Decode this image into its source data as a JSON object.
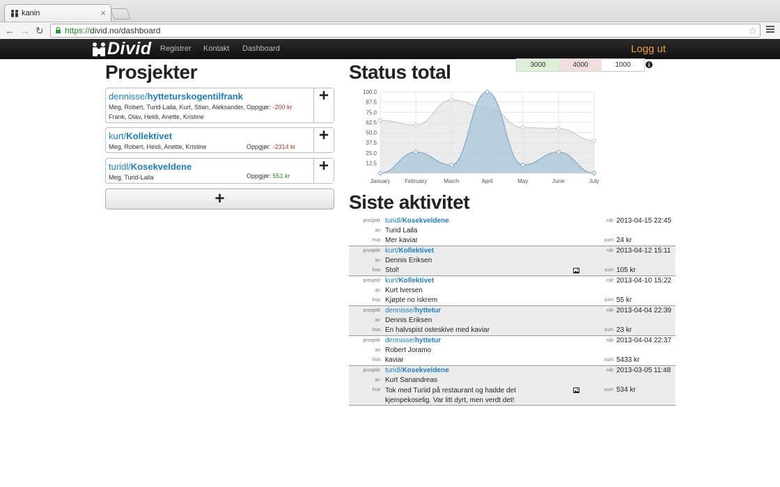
{
  "browser": {
    "tab_title": "kanin",
    "tab_close": "×",
    "url_https": "https://",
    "url_rest": "divid.no/dashboard",
    "back": "←",
    "forward": "→",
    "reload": "↻",
    "star": "☆"
  },
  "nav": {
    "brand": "Divid",
    "links": [
      "Registrer",
      "Kontakt",
      "Dashboard"
    ],
    "logout": "Logg ut"
  },
  "projects": {
    "title": "Prosjekter",
    "settle_label": "Oppgjør:",
    "add_symbol": "+",
    "items": [
      {
        "owner": "dennisse/",
        "name": "hytteturskogentilfrank",
        "members": "Meg, Robert, Turid-Laila, Kurt, Stian, Aleksander, Frank, Olav, Heidi, Anette, Kristine",
        "amount": "-200 kr",
        "sign": "neg"
      },
      {
        "owner": "kurt/",
        "name": "Kollektivet",
        "members": "Meg, Robert, Heidi, Anette, Kristine",
        "amount": "-2314 kr",
        "sign": "neg"
      },
      {
        "owner": "turidl/",
        "name": "Kosekveldene",
        "members": "Meg, Turid-Laila",
        "amount": "551 kr",
        "sign": "pos"
      }
    ]
  },
  "status": {
    "title": "Status total",
    "filters": [
      {
        "label": "3000",
        "color": "#dff0d8"
      },
      {
        "label": "4000",
        "color": "#f2dede"
      },
      {
        "label": "1000",
        "color": "#ffffff"
      }
    ]
  },
  "chart_data": {
    "type": "area",
    "categories": [
      "January",
      "February",
      "March",
      "April",
      "May",
      "June",
      "July"
    ],
    "yticks": [
      "100.0",
      "87.5",
      "75.0",
      "62.5",
      "50.0",
      "37.5",
      "25.0",
      "12.5"
    ],
    "ylim": [
      0,
      100
    ],
    "grid": true,
    "series": [
      {
        "values": [
          65,
          59,
          90,
          81,
          56,
          55,
          40
        ],
        "color": "#dcdcdc",
        "stroke": "#cfcfcf"
      },
      {
        "values": [
          0,
          26,
          10,
          100,
          10,
          26,
          0
        ],
        "color": "#a9c6d8",
        "stroke": "#8fb1c8"
      }
    ]
  },
  "activity": {
    "title": "Siste aktivitet",
    "labels": {
      "project": "prosjekt",
      "by": "av",
      "what": "hva",
      "when": "når",
      "sum": "sum"
    },
    "items": [
      {
        "owner": "turidl/",
        "name": "Kosekveldene",
        "by": "Turid Laila",
        "what": "Mer kaviar",
        "when": "2013-04-15 22:45",
        "sum": "24 kr",
        "image": false,
        "shaded": false
      },
      {
        "owner": "kurt/",
        "name": "Kollektivet",
        "by": "Dennis Eriksen",
        "what": "Stol!",
        "when": "2013-04-12 15:11",
        "sum": "105 kr",
        "image": true,
        "shaded": true
      },
      {
        "owner": "kurt/",
        "name": "Kollektivet",
        "by": "Kurt Iversen",
        "what": "Kjøpte no iskrem",
        "when": "2013-04-10 15:22",
        "sum": "55 kr",
        "image": false,
        "shaded": false
      },
      {
        "owner": "dennisse/",
        "name": "hyttetur",
        "by": "Dennis Eriksen",
        "what": "En halvspist osteskive med kaviar",
        "when": "2013-04-04 22:39",
        "sum": "23 kr",
        "image": false,
        "shaded": true
      },
      {
        "owner": "dennisse/",
        "name": "hyttetur",
        "by": "Robert Joramo",
        "what": "kaviar",
        "when": "2013-04-04 22:37",
        "sum": "5433 kr",
        "image": false,
        "shaded": false
      },
      {
        "owner": "turidl/",
        "name": "Kosekveldene",
        "by": "Kurt Sanandreas",
        "what": "Tok med Turiid på restaurant og hadde det kjempekoselig. Var litt dyrt, men verdt det!",
        "when": "2013-03-05 11:48",
        "sum": "534 kr",
        "image": true,
        "shaded": true
      }
    ]
  }
}
